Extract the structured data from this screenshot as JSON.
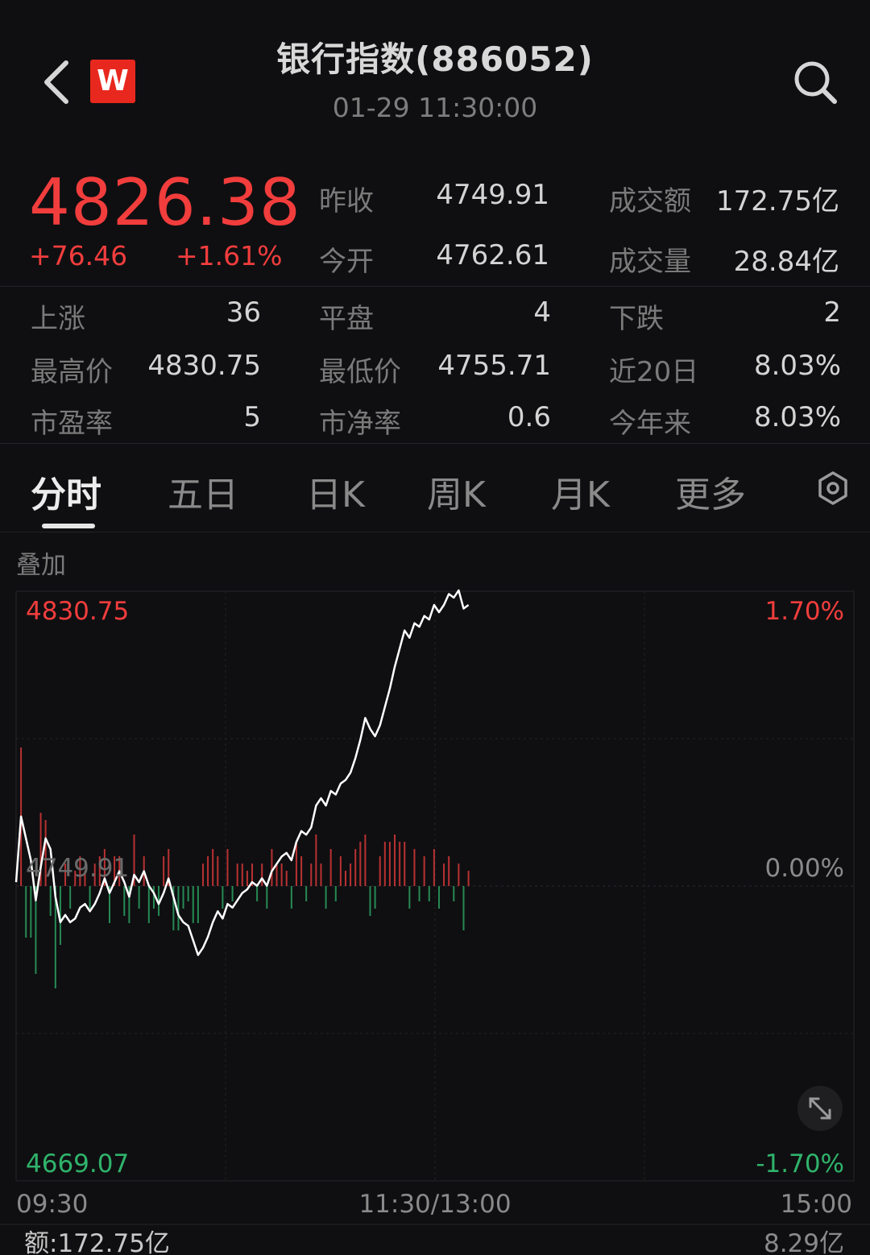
{
  "header": {
    "title": "银行指数(886052)",
    "subtitle": "01-29 11:30:00",
    "logo_letter": "W",
    "back_icon": "chevron-left-icon",
    "search_icon": "search-icon"
  },
  "quote": {
    "price": "4826.38",
    "change": "+76.46",
    "change_pct": "+1.61%",
    "stats_row1": [
      {
        "label": "昨收",
        "value": "4749.91"
      },
      {
        "label": "成交额",
        "value": "172.75亿"
      }
    ],
    "stats_row2": [
      {
        "label": "今开",
        "value": "4762.61"
      },
      {
        "label": "成交量",
        "value": "28.84亿"
      }
    ]
  },
  "breadth": [
    [
      {
        "label": "上涨",
        "value": "36"
      },
      {
        "label": "平盘",
        "value": "4"
      },
      {
        "label": "下跌",
        "value": "2"
      }
    ],
    [
      {
        "label": "最高价",
        "value": "4830.75"
      },
      {
        "label": "最低价",
        "value": "4755.71"
      },
      {
        "label": "近20日",
        "value": "8.03%"
      }
    ],
    [
      {
        "label": "市盈率",
        "value": "5"
      },
      {
        "label": "市净率",
        "value": "0.6"
      },
      {
        "label": "今年来",
        "value": "8.03%"
      }
    ]
  ],
  "tabs": [
    "分时",
    "五日",
    "日K",
    "周K",
    "月K",
    "更多"
  ],
  "active_tab": 0,
  "settings_icon": "settings-hexagon-icon",
  "overlay_label": "叠加",
  "colors": {
    "up": "#f23d3d",
    "down": "#2fb36b",
    "line": "#ffffff",
    "bg": "#0f0f11"
  },
  "chart_data": {
    "type": "line",
    "y_labels_left": {
      "top": "4830.75",
      "mid": "4749.91",
      "bottom": "4669.07"
    },
    "y_labels_right": {
      "top": "1.70%",
      "mid": "0.00%",
      "bottom": "-1.70%"
    },
    "x_labels": [
      "09:30",
      "11:30/13:00",
      "15:00"
    ],
    "ylim": [
      4669.07,
      4830.75
    ],
    "prev_close": 4749.91,
    "x_minutes_total": 240,
    "price_series": [
      4751,
      4769,
      4763,
      4757,
      4746,
      4755,
      4763,
      4760,
      4747,
      4740,
      4742,
      4740,
      4741,
      4744,
      4745,
      4743,
      4745,
      4748,
      4752,
      4748,
      4751,
      4754,
      4751,
      4747,
      4753,
      4751,
      4754,
      4750,
      4748,
      4745,
      4748,
      4752,
      4747,
      4742,
      4740,
      4739,
      4735,
      4731,
      4733,
      4736,
      4740,
      4743,
      4741,
      4745,
      4744,
      4746,
      4748,
      4749,
      4751,
      4750,
      4752,
      4750,
      4754,
      4756,
      4758,
      4759,
      4757,
      4762,
      4765,
      4764,
      4766,
      4772,
      4774,
      4772,
      4776,
      4775,
      4778,
      4779,
      4781,
      4785,
      4790,
      4796,
      4793,
      4791,
      4794,
      4799,
      4804,
      4810,
      4815,
      4820,
      4818,
      4822,
      4821,
      4824,
      4823,
      4827,
      4825,
      4827,
      4830,
      4829,
      4831,
      4826,
      4827
    ],
    "volume_label": "额:172.75亿",
    "volume_right_label": "8.29亿"
  }
}
